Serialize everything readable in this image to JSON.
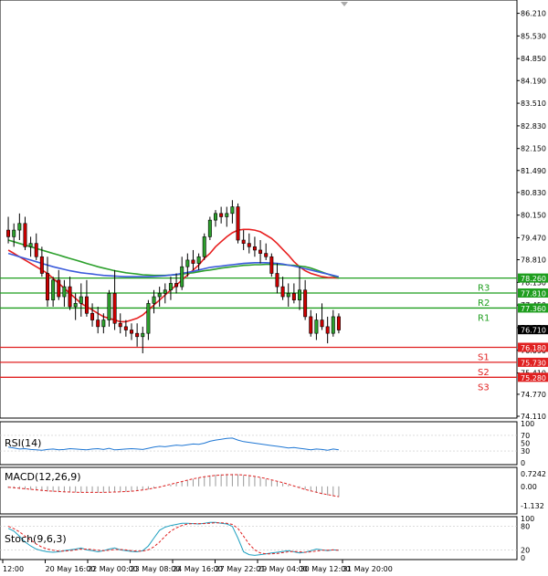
{
  "chart_data": {
    "type": "candlestick",
    "main_panel": {
      "ylim": [
        74.11,
        86.5
      ],
      "y_ticks": [
        "86.210",
        "85.530",
        "84.850",
        "84.190",
        "83.510",
        "82.830",
        "82.150",
        "81.490",
        "80.830",
        "80.150",
        "79.470",
        "78.810",
        "78.130",
        "77.450",
        "76.770",
        "76.090",
        "75.410",
        "74.770",
        "74.110"
      ],
      "candles": [
        [
          79.7,
          80.1,
          79.3,
          79.5
        ],
        [
          79.5,
          79.9,
          79.2,
          79.7
        ],
        [
          79.7,
          80.2,
          79.4,
          79.9
        ],
        [
          79.9,
          80.1,
          79.1,
          79.2
        ],
        [
          79.2,
          79.5,
          78.9,
          79.3
        ],
        [
          79.3,
          79.6,
          78.8,
          78.9
        ],
        [
          78.9,
          79.2,
          78.3,
          78.4
        ],
        [
          78.4,
          78.9,
          77.4,
          77.6
        ],
        [
          77.6,
          78.3,
          77.4,
          78.2
        ],
        [
          78.2,
          78.5,
          77.6,
          77.7
        ],
        [
          77.7,
          78.2,
          77.4,
          78.0
        ],
        [
          78.0,
          78.3,
          77.3,
          77.4
        ],
        [
          77.4,
          77.8,
          77.0,
          77.5
        ],
        [
          77.5,
          78.1,
          77.1,
          77.7
        ],
        [
          77.7,
          78.2,
          77.1,
          77.2
        ],
        [
          77.2,
          77.5,
          76.8,
          77.0
        ],
        [
          77.0,
          77.4,
          76.6,
          76.8
        ],
        [
          76.8,
          77.2,
          76.6,
          77.0
        ],
        [
          77.0,
          77.9,
          76.8,
          77.8
        ],
        [
          77.8,
          78.5,
          76.7,
          76.9
        ],
        [
          76.9,
          77.2,
          76.6,
          76.8
        ],
        [
          76.8,
          77.0,
          76.5,
          76.7
        ],
        [
          76.7,
          76.9,
          76.4,
          76.6
        ],
        [
          76.6,
          76.9,
          76.2,
          76.5
        ],
        [
          76.5,
          76.8,
          76.0,
          76.6
        ],
        [
          76.6,
          77.6,
          76.4,
          77.5
        ],
        [
          77.5,
          77.9,
          77.2,
          77.7
        ],
        [
          77.7,
          78.0,
          77.4,
          77.8
        ],
        [
          77.8,
          78.1,
          77.5,
          77.9
        ],
        [
          77.9,
          78.3,
          77.6,
          78.1
        ],
        [
          78.1,
          78.4,
          77.8,
          78.0
        ],
        [
          78.0,
          78.9,
          77.9,
          78.6
        ],
        [
          78.6,
          79.0,
          78.3,
          78.8
        ],
        [
          78.8,
          79.1,
          78.5,
          78.7
        ],
        [
          78.7,
          79.0,
          78.5,
          78.9
        ],
        [
          78.9,
          79.6,
          78.8,
          79.5
        ],
        [
          79.5,
          80.1,
          79.4,
          80.0
        ],
        [
          80.0,
          80.3,
          79.8,
          80.2
        ],
        [
          80.2,
          80.4,
          79.9,
          80.1
        ],
        [
          80.1,
          80.4,
          79.8,
          80.2
        ],
        [
          80.2,
          80.6,
          79.9,
          80.4
        ],
        [
          80.4,
          80.5,
          79.3,
          79.4
        ],
        [
          79.4,
          79.7,
          79.1,
          79.3
        ],
        [
          79.3,
          79.6,
          79.0,
          79.2
        ],
        [
          79.2,
          79.5,
          78.9,
          79.1
        ],
        [
          79.1,
          79.4,
          78.7,
          79.0
        ],
        [
          79.0,
          79.3,
          78.8,
          78.9
        ],
        [
          78.9,
          79.0,
          78.3,
          78.4
        ],
        [
          78.4,
          78.7,
          77.8,
          78.0
        ],
        [
          78.0,
          78.3,
          77.6,
          77.7
        ],
        [
          77.7,
          78.1,
          77.4,
          77.8
        ],
        [
          77.8,
          78.1,
          77.5,
          77.6
        ],
        [
          77.6,
          78.6,
          77.3,
          77.9
        ],
        [
          77.9,
          78.2,
          77.0,
          77.1
        ],
        [
          77.1,
          77.3,
          76.5,
          76.6
        ],
        [
          76.6,
          77.2,
          76.4,
          77.0
        ],
        [
          77.0,
          77.5,
          76.7,
          76.8
        ],
        [
          76.8,
          77.1,
          76.3,
          76.6
        ],
        [
          76.6,
          77.3,
          76.5,
          77.1
        ],
        [
          77.1,
          77.2,
          76.6,
          76.7
        ]
      ],
      "series": [
        {
          "name": "",
          "color": "#e82020",
          "values": [
            79.1,
            79.0,
            78.9,
            78.8,
            78.7,
            78.6,
            78.5,
            78.4,
            78.25,
            78.1,
            77.95,
            77.8,
            77.65,
            77.5,
            77.4,
            77.3,
            77.2,
            77.1,
            77.05,
            77.0,
            76.95,
            76.95,
            77.0,
            77.05,
            77.15,
            77.3,
            77.45,
            77.6,
            77.75,
            77.9,
            78.05,
            78.2,
            78.35,
            78.5,
            78.65,
            78.85,
            79.0,
            79.2,
            79.35,
            79.5,
            79.62,
            79.7,
            79.72,
            79.72,
            79.7,
            79.65,
            79.55,
            79.45,
            79.3,
            79.12,
            78.95,
            78.75,
            78.6,
            78.48,
            78.4,
            78.35,
            78.3,
            78.28,
            78.27,
            78.26
          ]
        },
        {
          "name": "",
          "color": "#2ca02c",
          "values": [
            79.4,
            79.35,
            79.3,
            79.25,
            79.2,
            79.15,
            79.1,
            79.05,
            79.0,
            78.95,
            78.9,
            78.85,
            78.8,
            78.75,
            78.7,
            78.65,
            78.6,
            78.56,
            78.52,
            78.48,
            78.45,
            78.42,
            78.4,
            78.38,
            78.36,
            78.35,
            78.34,
            78.34,
            78.34,
            78.35,
            78.36,
            78.38,
            78.4,
            78.42,
            78.45,
            78.48,
            78.5,
            78.53,
            78.56,
            78.58,
            78.6,
            78.62,
            78.64,
            78.65,
            78.66,
            78.66,
            78.67,
            78.67,
            78.67,
            78.66,
            78.65,
            78.64,
            78.62,
            78.6,
            78.56,
            78.5,
            78.44,
            78.38,
            78.32,
            78.26
          ]
        },
        {
          "name": "",
          "color": "#3b5bdb",
          "values": [
            79.0,
            78.95,
            78.9,
            78.85,
            78.8,
            78.75,
            78.7,
            78.65,
            78.6,
            78.56,
            78.52,
            78.48,
            78.45,
            78.42,
            78.4,
            78.38,
            78.36,
            78.34,
            78.33,
            78.32,
            78.31,
            78.3,
            78.3,
            78.3,
            78.3,
            78.3,
            78.31,
            78.32,
            78.33,
            78.35,
            78.37,
            78.4,
            78.43,
            78.46,
            78.5,
            78.54,
            78.58,
            78.6,
            78.62,
            78.64,
            78.66,
            78.68,
            78.7,
            78.71,
            78.72,
            78.72,
            78.72,
            78.71,
            78.7,
            78.68,
            78.65,
            78.62,
            78.58,
            78.54,
            78.5,
            78.46,
            78.42,
            78.38,
            78.34,
            78.3
          ]
        }
      ],
      "levels": [
        {
          "id": "R3",
          "value": 78.26,
          "price_label": "78.260",
          "color": "#1e9e1e"
        },
        {
          "id": "R2",
          "value": 77.81,
          "price_label": "77.810",
          "color": "#1e9e1e"
        },
        {
          "id": "R1",
          "value": 77.36,
          "price_label": "77.360",
          "color": "#1e9e1e"
        },
        {
          "id": "S1",
          "value": 76.18,
          "price_label": "76.180",
          "color": "#e02020"
        },
        {
          "id": "S2",
          "value": 75.73,
          "price_label": "75.730",
          "color": "#e02020"
        },
        {
          "id": "S3",
          "value": 75.28,
          "price_label": "75.280",
          "color": "#e02020"
        }
      ],
      "current_price": {
        "value": 76.71,
        "label": "76.710"
      }
    },
    "rsi_panel": {
      "title": "RSI(14)",
      "ylim": [
        0,
        100
      ],
      "y_ticks": [
        "100",
        "70",
        "50",
        "30",
        "0"
      ],
      "color": "#1f77d4",
      "values": [
        40,
        38,
        35,
        36,
        34,
        33,
        32,
        34,
        35,
        33,
        34,
        36,
        35,
        34,
        33,
        35,
        36,
        34,
        37,
        33,
        34,
        35,
        36,
        35,
        34,
        37,
        40,
        42,
        41,
        43,
        45,
        44,
        46,
        48,
        47,
        50,
        55,
        58,
        60,
        62,
        63,
        58,
        54,
        52,
        50,
        48,
        46,
        44,
        42,
        40,
        38,
        39,
        37,
        35,
        33,
        35,
        34,
        32,
        35,
        33
      ]
    },
    "macd_panel": {
      "title": "MACD(12,26,9)",
      "ylim": [
        -1.5,
        1.0
      ],
      "y_ticks": [
        "0.7242",
        "0.00",
        "-1.132"
      ],
      "hist_color": "#999999",
      "signal_color": "#e02020",
      "hist": [
        -0.1,
        -0.12,
        -0.15,
        -0.18,
        -0.2,
        -0.24,
        -0.28,
        -0.3,
        -0.32,
        -0.34,
        -0.35,
        -0.36,
        -0.36,
        -0.37,
        -0.38,
        -0.38,
        -0.38,
        -0.37,
        -0.36,
        -0.35,
        -0.34,
        -0.32,
        -0.3,
        -0.27,
        -0.23,
        -0.18,
        -0.12,
        -0.05,
        0.02,
        0.1,
        0.18,
        0.26,
        0.34,
        0.42,
        0.5,
        0.58,
        0.64,
        0.68,
        0.7,
        0.72,
        0.72,
        0.7,
        0.66,
        0.62,
        0.56,
        0.5,
        0.44,
        0.36,
        0.28,
        0.18,
        0.08,
        -0.02,
        -0.1,
        -0.2,
        -0.3,
        -0.38,
        -0.46,
        -0.52,
        -0.58,
        -0.62
      ],
      "signal": [
        -0.05,
        -0.08,
        -0.11,
        -0.14,
        -0.17,
        -0.2,
        -0.23,
        -0.26,
        -0.28,
        -0.3,
        -0.32,
        -0.33,
        -0.34,
        -0.35,
        -0.35,
        -0.35,
        -0.35,
        -0.35,
        -0.34,
        -0.33,
        -0.32,
        -0.3,
        -0.28,
        -0.25,
        -0.21,
        -0.16,
        -0.1,
        -0.04,
        0.04,
        0.12,
        0.2,
        0.28,
        0.36,
        0.44,
        0.5,
        0.56,
        0.6,
        0.64,
        0.66,
        0.68,
        0.68,
        0.68,
        0.66,
        0.63,
        0.58,
        0.52,
        0.46,
        0.38,
        0.3,
        0.22,
        0.12,
        0.02,
        -0.08,
        -0.18,
        -0.26,
        -0.34,
        -0.42,
        -0.48,
        -0.54,
        -0.6
      ]
    },
    "stoch_panel": {
      "title": "Stoch(9,6,3)",
      "ylim": [
        0,
        100
      ],
      "y_ticks": [
        "100",
        "80",
        "20",
        "0"
      ],
      "k_color": "#1fa0c0",
      "d_color": "#e02020",
      "k": [
        75,
        68,
        55,
        40,
        30,
        22,
        18,
        15,
        14,
        15,
        18,
        20,
        22,
        25,
        20,
        18,
        15,
        18,
        22,
        25,
        20,
        18,
        16,
        15,
        18,
        30,
        50,
        70,
        78,
        82,
        85,
        88,
        88,
        87,
        86,
        88,
        90,
        90,
        88,
        86,
        80,
        50,
        15,
        8,
        6,
        8,
        10,
        12,
        14,
        16,
        18,
        15,
        12,
        14,
        18,
        22,
        20,
        18,
        20,
        19
      ],
      "d": [
        80,
        74,
        66,
        55,
        45,
        35,
        27,
        22,
        19,
        17,
        17,
        18,
        20,
        22,
        22,
        21,
        19,
        18,
        19,
        21,
        21,
        20,
        18,
        17,
        17,
        20,
        28,
        40,
        55,
        68,
        76,
        82,
        86,
        87,
        87,
        87,
        88,
        89,
        89,
        88,
        85,
        75,
        55,
        35,
        20,
        12,
        10,
        10,
        11,
        13,
        15,
        16,
        15,
        14,
        15,
        17,
        19,
        19,
        20,
        19
      ]
    },
    "x_axis_labels": [
      "12:00",
      "20 May 16:00",
      "22 May 00:00",
      "23 May 08:00",
      "24 May 16:00",
      "27 May 22:01",
      "29 May 04:00",
      "30 May 12:00",
      "31 May 20:00"
    ]
  }
}
